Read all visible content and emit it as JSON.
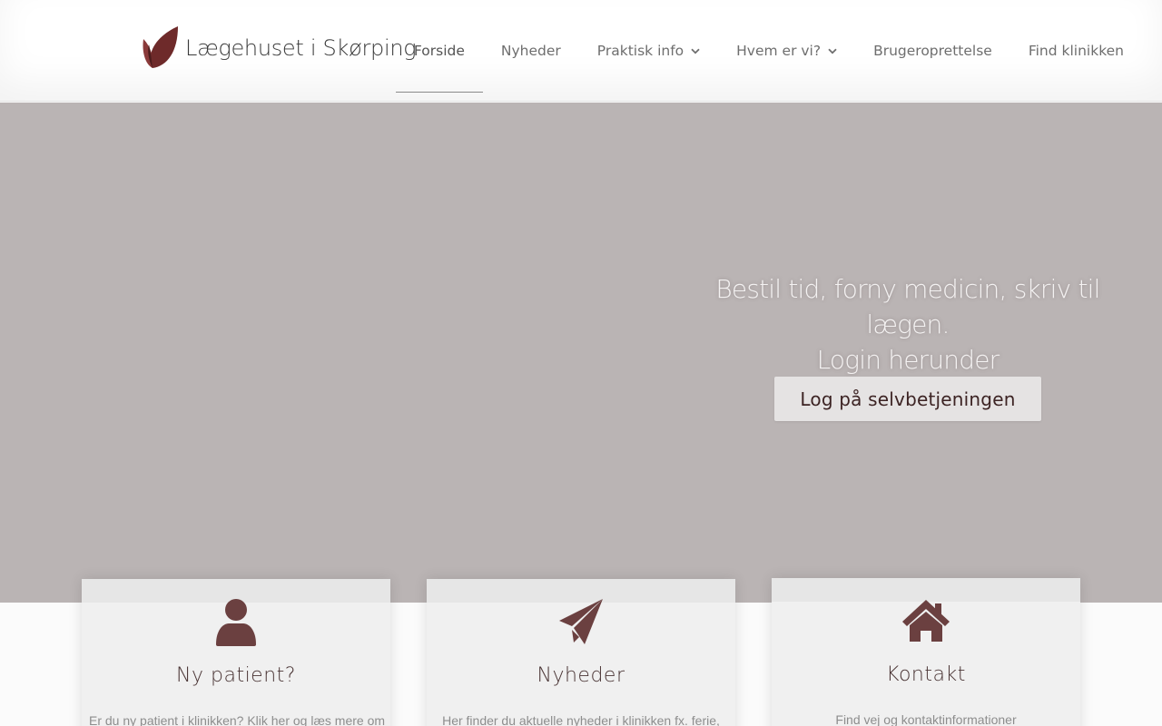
{
  "brand": {
    "name": "Lægehuset i Skørping",
    "logo_icon": "leaf-logo-icon",
    "color": "#6b2b2b"
  },
  "nav": {
    "items": [
      {
        "label": "Forside",
        "active": true,
        "dropdown": false
      },
      {
        "label": "Nyheder",
        "active": false,
        "dropdown": false
      },
      {
        "label": "Praktisk info",
        "active": false,
        "dropdown": true
      },
      {
        "label": "Hvem er vi?",
        "active": false,
        "dropdown": true
      },
      {
        "label": "Brugeroprettelse",
        "active": false,
        "dropdown": false
      },
      {
        "label": "Find klinikken",
        "active": false,
        "dropdown": false
      }
    ]
  },
  "hero": {
    "heading_line1": "Bestil tid, forny medicin, skriv til lægen.",
    "heading_line2": "Login herunder",
    "button_label": "Log på selvbetjeningen",
    "background": "#bab4b4"
  },
  "cards": [
    {
      "icon": "user-icon",
      "title": "Ny patient?",
      "text": "Er du ny patient i klinikken? Klik her og læs mere om"
    },
    {
      "icon": "paper-plane-icon",
      "title": "Nyheder",
      "text": "Her finder du aktuelle nyheder i klinikken fx. ferie,"
    },
    {
      "icon": "home-icon",
      "title": "Kontakt",
      "text": "Find vej og kontaktinformationer"
    }
  ],
  "accent_color": "#6b4040"
}
